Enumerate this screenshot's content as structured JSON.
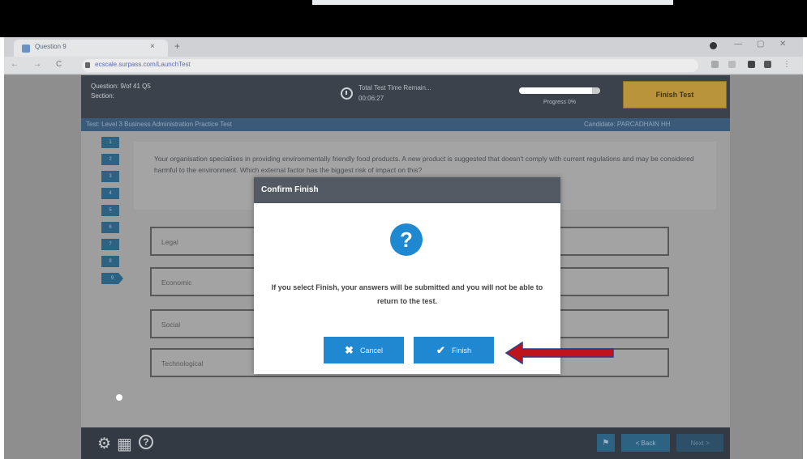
{
  "browser": {
    "tab_title": "Question 9",
    "tab_close": "×",
    "new_tab": "+",
    "url": "ecscale.surpass.com/LaunchTest",
    "back": "←",
    "forward": "→",
    "reload": "C",
    "win_min": "—",
    "win_max": "▢",
    "win_close": "✕"
  },
  "header": {
    "question_line": "Question: 9/of 41 Q5",
    "section_line": "Section:",
    "timer_label": "Total Test Time Remain...",
    "timer_value": "00:06:27",
    "progress_label": "Progress 0%",
    "progress_fraction": 0.9,
    "finish_test_label": "Finish Test"
  },
  "subheader": {
    "test_name": "Test: Level 3 Business Administration Practice Test",
    "candidate": "Candidate: PARCADHAIN HH"
  },
  "question_nav": [
    "1",
    "2",
    "3",
    "4",
    "5",
    "6",
    "7",
    "8",
    "9"
  ],
  "question": {
    "text": "Your organisation specialises in providing environmentally friendly food products. A new product is suggested that doesn't comply with current regulations and may be considered harmful to the environment. Which external factor has the biggest risk of impact on this?"
  },
  "answers": [
    "Legal",
    "Economic",
    "Social",
    "Technological"
  ],
  "footer": {
    "gear_icon": "⚙",
    "grid_icon": "▦",
    "help_icon": "?",
    "flag_icon": "⚑",
    "back_label": "< Back",
    "next_label": "Next >"
  },
  "modal": {
    "title": "Confirm Finish",
    "icon": "?",
    "message": "If you select Finish, your answers will be submitted and you will not be able to return to the test.",
    "cancel_label": "Cancel",
    "cancel_icon": "✖",
    "finish_label": "Finish",
    "finish_icon": "✔"
  },
  "colors": {
    "accent_blue": "#1f88d0",
    "finish_gold": "#b9943a",
    "annotation_arrow": "#c0141c"
  }
}
